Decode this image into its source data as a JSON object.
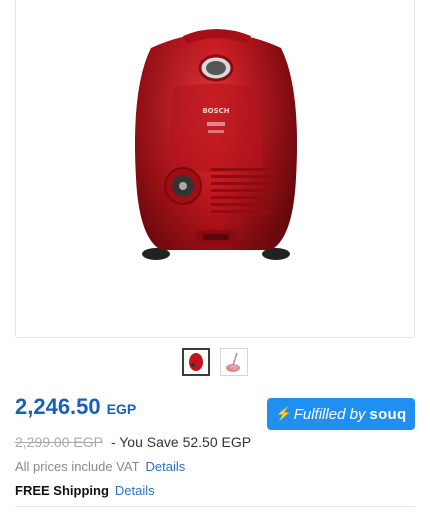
{
  "product": {
    "image_icon": "red-vacuum-cleaner-image",
    "brand_on_body": "BOSCH",
    "thumbnails": [
      {
        "icon": "vacuum-thumbnail-icon",
        "active": true
      },
      {
        "icon": "vacuum-accessory-thumbnail-icon",
        "active": false
      }
    ]
  },
  "pricing": {
    "price": "2,246.50",
    "currency": "EGP",
    "old_price": "2,299.00 EGP",
    "savings": "- You Save 52.50 EGP",
    "vat_text": "All prices include VAT",
    "vat_link": "Details",
    "shipping_label": "FREE Shipping",
    "shipping_link": "Details"
  },
  "badge": {
    "fulfilled_text": "Fulfilled by",
    "fulfilled_brand": "souq",
    "color": "#1f8ff2"
  },
  "colors": {
    "price_blue": "#1b5fb8",
    "link_blue": "#2a71c9",
    "product_red": "#c0151c"
  }
}
